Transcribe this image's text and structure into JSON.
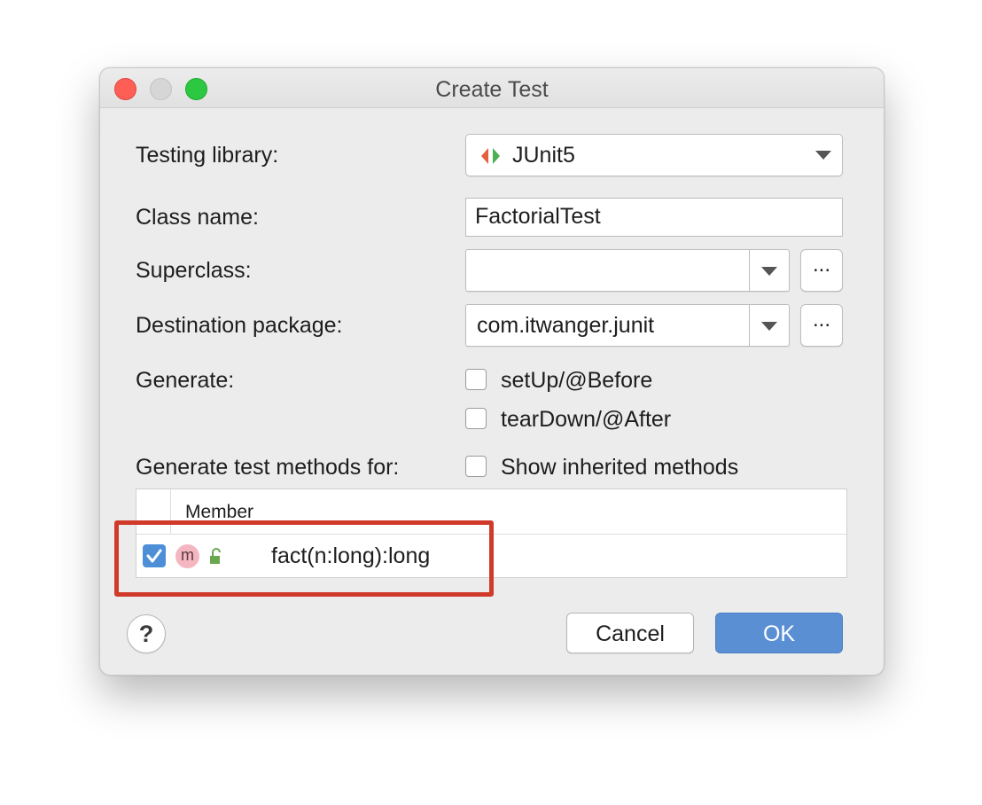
{
  "window": {
    "title": "Create Test",
    "controls": [
      "close",
      "minimize",
      "maximize"
    ]
  },
  "form": {
    "testing_library": {
      "label": "Testing library:",
      "value": "JUnit5",
      "icon": "junit-icon"
    },
    "class_name": {
      "label": "Class name:",
      "value": "FactorialTest"
    },
    "superclass": {
      "label": "Superclass:",
      "value": "",
      "browse_label": "..."
    },
    "destination_package": {
      "label": "Destination package:",
      "value": "com.itwanger.junit",
      "browse_label": "..."
    },
    "generate": {
      "label": "Generate:",
      "options": [
        {
          "label": "setUp/@Before",
          "checked": false
        },
        {
          "label": "tearDown/@After",
          "checked": false
        }
      ]
    },
    "generate_methods": {
      "label": "Generate test methods for:",
      "show_inherited": {
        "label": "Show inherited methods",
        "checked": false
      }
    }
  },
  "table": {
    "columns": [
      "Member"
    ],
    "rows": [
      {
        "checked": true,
        "icon": "method-icon",
        "icon_letter": "m",
        "visibility_icon": "unlock-icon",
        "member": "fact(n:long):long"
      }
    ]
  },
  "footer": {
    "help_label": "?",
    "cancel_label": "Cancel",
    "ok_label": "OK"
  },
  "colors": {
    "accent": "#5b8fd4",
    "highlight": "#d03a2a",
    "checkbox_checked": "#4c8fd7"
  }
}
